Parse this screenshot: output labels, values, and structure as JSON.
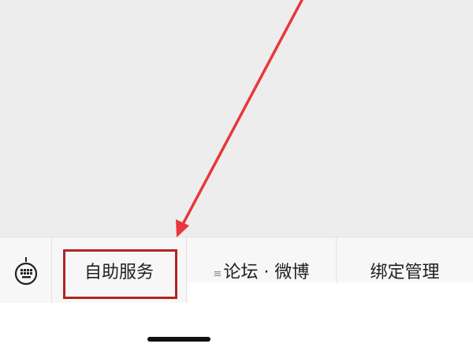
{
  "menu": {
    "items": [
      {
        "label": "自助服务",
        "icon": ""
      },
      {
        "label": "论坛 · 微博",
        "icon": "≡"
      },
      {
        "label": "绑定管理",
        "icon": ""
      }
    ],
    "keyboard_icon": "keyboard-icon"
  },
  "annotation": {
    "arrow_color": "#e8373a",
    "box_color": "#b52222"
  }
}
